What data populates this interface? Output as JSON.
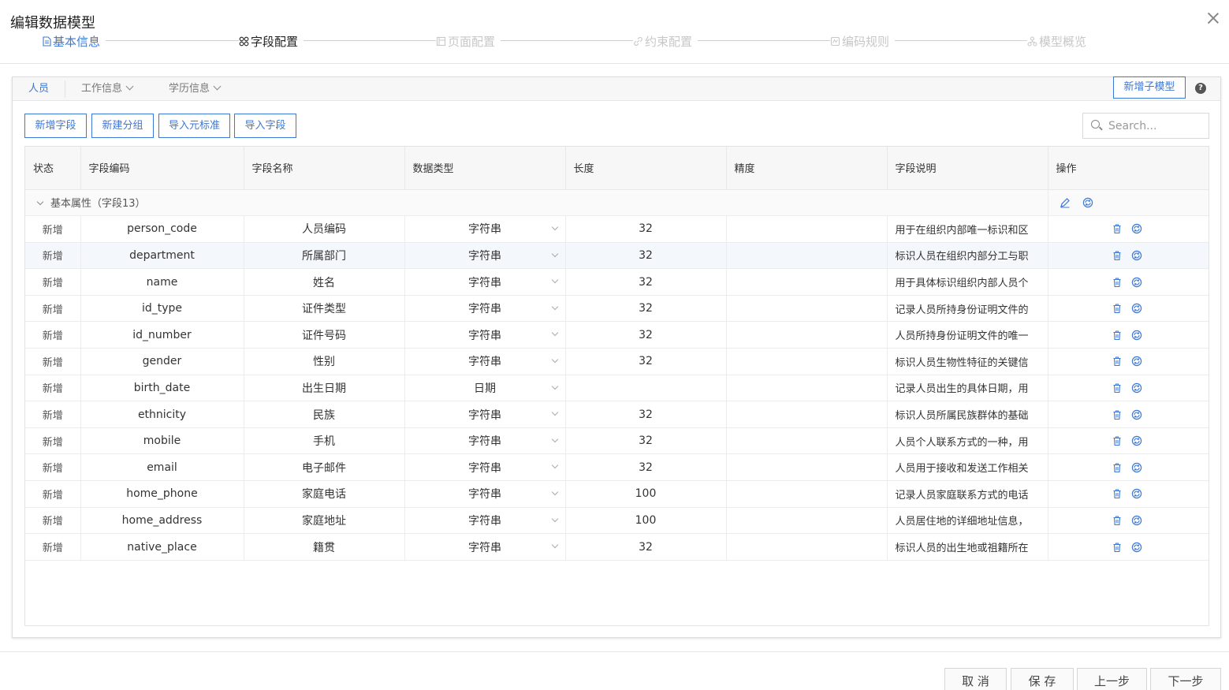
{
  "dialog": {
    "title": "编辑数据模型"
  },
  "steps": [
    {
      "label": "基本信息",
      "icon": "document-icon",
      "state": "done"
    },
    {
      "label": "字段配置",
      "icon": "grid-icon",
      "state": "active"
    },
    {
      "label": "页面配置",
      "icon": "layout-icon",
      "state": "pending"
    },
    {
      "label": "约束配置",
      "icon": "link-icon",
      "state": "pending"
    },
    {
      "label": "编码规则",
      "icon": "code-icon",
      "state": "pending"
    },
    {
      "label": "模型概览",
      "icon": "hierarchy-icon",
      "state": "pending"
    }
  ],
  "tabs": [
    {
      "label": "人员",
      "active": true
    },
    {
      "label": "工作信息",
      "active": false
    },
    {
      "label": "学历信息",
      "active": false
    }
  ],
  "tabbar": {
    "add_submodel_label": "新增子模型",
    "help": "?"
  },
  "toolbar": {
    "add_field": "新增字段",
    "new_group": "新建分组",
    "import_meta": "导入元标准",
    "import_field": "导入字段",
    "search_placeholder": "Search..."
  },
  "table": {
    "headers": [
      "状态",
      "字段编码",
      "字段名称",
      "数据类型",
      "长度",
      "精度",
      "字段说明",
      "操作"
    ],
    "group": {
      "label": "基本属性（字段13）"
    },
    "rows": [
      {
        "status": "新增",
        "code": "person_code",
        "name": "人员编码",
        "type": "字符串",
        "length": "32",
        "precision": "",
        "desc": "用于在组织内部唯一标识和区"
      },
      {
        "status": "新增",
        "code": "department",
        "name": "所属部门",
        "type": "字符串",
        "length": "32",
        "precision": "",
        "desc": "标识人员在组织内部分工与职"
      },
      {
        "status": "新增",
        "code": "name",
        "name": "姓名",
        "type": "字符串",
        "length": "32",
        "precision": "",
        "desc": "用于具体标识组织内部人员个"
      },
      {
        "status": "新增",
        "code": "id_type",
        "name": "证件类型",
        "type": "字符串",
        "length": "32",
        "precision": "",
        "desc": "记录人员所持身份证明文件的"
      },
      {
        "status": "新增",
        "code": "id_number",
        "name": "证件号码",
        "type": "字符串",
        "length": "32",
        "precision": "",
        "desc": "人员所持身份证明文件的唯一"
      },
      {
        "status": "新增",
        "code": "gender",
        "name": "性别",
        "type": "字符串",
        "length": "32",
        "precision": "",
        "desc": "标识人员生物性特征的关键信"
      },
      {
        "status": "新增",
        "code": "birth_date",
        "name": "出生日期",
        "type": "日期",
        "length": "",
        "precision": "",
        "desc": "记录人员出生的具体日期，用"
      },
      {
        "status": "新增",
        "code": "ethnicity",
        "name": "民族",
        "type": "字符串",
        "length": "32",
        "precision": "",
        "desc": "标识人员所属民族群体的基础"
      },
      {
        "status": "新增",
        "code": "mobile",
        "name": "手机",
        "type": "字符串",
        "length": "32",
        "precision": "",
        "desc": "人员个人联系方式的一种，用"
      },
      {
        "status": "新增",
        "code": "email",
        "name": "电子邮件",
        "type": "字符串",
        "length": "32",
        "precision": "",
        "desc": "人员用于接收和发送工作相关"
      },
      {
        "status": "新增",
        "code": "home_phone",
        "name": "家庭电话",
        "type": "字符串",
        "length": "100",
        "precision": "",
        "desc": "记录人员家庭联系方式的电话"
      },
      {
        "status": "新增",
        "code": "home_address",
        "name": "家庭地址",
        "type": "字符串",
        "length": "100",
        "precision": "",
        "desc": "人员居住地的详细地址信息，"
      },
      {
        "status": "新增",
        "code": "native_place",
        "name": "籍贯",
        "type": "字符串",
        "length": "32",
        "precision": "",
        "desc": "标识人员的出生地或祖籍所在"
      }
    ]
  },
  "footer": {
    "cancel": "取 消",
    "save": "保 存",
    "prev": "上一步",
    "next": "下一步"
  },
  "colors": {
    "accent": "#3c78d8",
    "text": "#333333",
    "muted": "#c7c7c7"
  }
}
